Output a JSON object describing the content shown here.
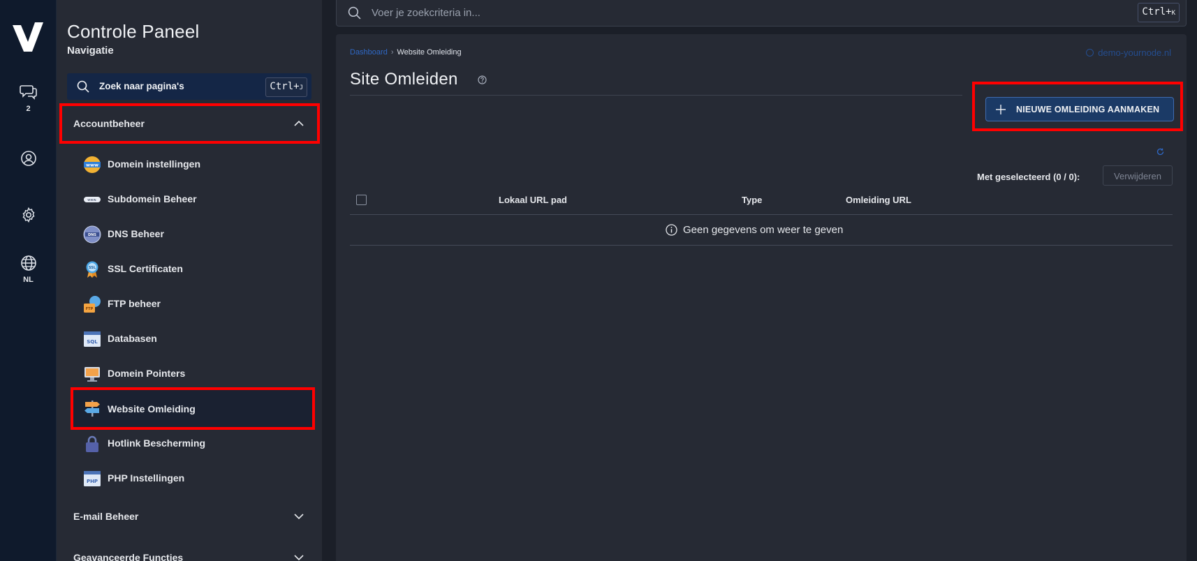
{
  "rail": {
    "chat_count": "2",
    "language": "NL"
  },
  "sidebar": {
    "title": "Controle Paneel",
    "subtitle": "Navigatie",
    "search_placeholder": "Zoek naar pagina's",
    "search_shortcut": "Ctrl+",
    "search_shortcut_key": "J",
    "groups": [
      {
        "label": "Accountbeheer",
        "expanded": true
      },
      {
        "label": "E-mail Beheer",
        "expanded": false
      },
      {
        "label": "Geavanceerde Functies",
        "expanded": false
      }
    ],
    "items": [
      {
        "label": "Domein instellingen",
        "icon": "www-globe-icon"
      },
      {
        "label": "Subdomein Beheer",
        "icon": "subdomain-icon"
      },
      {
        "label": "DNS Beheer",
        "icon": "dns-globe-icon"
      },
      {
        "label": "SSL Certificaten",
        "icon": "ssl-badge-icon"
      },
      {
        "label": "FTP beheer",
        "icon": "ftp-folder-icon"
      },
      {
        "label": "Databasen",
        "icon": "sql-window-icon"
      },
      {
        "label": "Domein Pointers",
        "icon": "pointer-monitor-icon"
      },
      {
        "label": "Website Omleiding",
        "icon": "signpost-icon",
        "active": true
      },
      {
        "label": "Hotlink Bescherming",
        "icon": "padlock-icon"
      },
      {
        "label": "PHP Instellingen",
        "icon": "php-window-icon"
      }
    ]
  },
  "topbar": {
    "search_placeholder": "Voer je zoekcriteria in...",
    "shortcut": "Ctrl+",
    "shortcut_key": "K"
  },
  "main": {
    "breadcrumb_root": "Dashboard",
    "breadcrumb_current": "Website Omleiding",
    "domain": "demo-yournode.nl",
    "title": "Site Omleiden",
    "new_button": "NIEUWE OMLEIDING AANMAKEN",
    "selected_label": "Met geselecteerd (0 / 0):",
    "delete_button": "Verwijderen",
    "columns": [
      "Lokaal URL pad",
      "Type",
      "Omleiding URL"
    ],
    "empty_message": "Geen gegevens om weer te geven"
  },
  "colors": {
    "highlight": "#ff0000",
    "accent": "#2f69c7",
    "rail_bg": "#0f1a2c",
    "panel_bg": "#262a34",
    "page_bg": "#1b1f28"
  }
}
